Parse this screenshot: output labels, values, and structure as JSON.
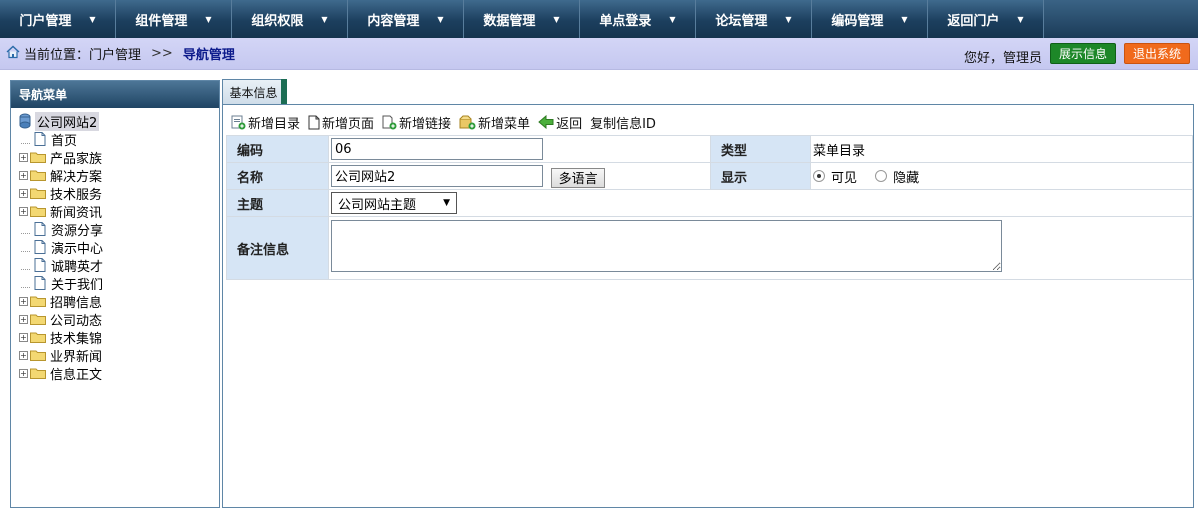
{
  "top_menu": [
    {
      "label": "门户管理"
    },
    {
      "label": "组件管理"
    },
    {
      "label": "组织权限"
    },
    {
      "label": "内容管理"
    },
    {
      "label": "数据管理"
    },
    {
      "label": "单点登录"
    },
    {
      "label": "论坛管理"
    },
    {
      "label": "编码管理"
    },
    {
      "label": "返回门户"
    }
  ],
  "breadcrumb": {
    "prefix": "当前位置：门户管理",
    "separator": ">>",
    "current": "导航管理"
  },
  "header": {
    "greeting": "您好，管理员",
    "show_info": "展示信息",
    "exit": "退出系统"
  },
  "left_panel": {
    "title": "导航菜单",
    "root": "公司网站2",
    "items": [
      {
        "label": "首页",
        "type": "page"
      },
      {
        "label": "产品家族",
        "type": "folder"
      },
      {
        "label": "解决方案",
        "type": "folder"
      },
      {
        "label": "技术服务",
        "type": "folder"
      },
      {
        "label": "新闻资讯",
        "type": "folder"
      },
      {
        "label": "资源分享",
        "type": "page"
      },
      {
        "label": "演示中心",
        "type": "page"
      },
      {
        "label": "诚聘英才",
        "type": "page"
      },
      {
        "label": "关于我们",
        "type": "page"
      },
      {
        "label": "招聘信息",
        "type": "folder"
      },
      {
        "label": "公司动态",
        "type": "folder"
      },
      {
        "label": "技术集锦",
        "type": "folder"
      },
      {
        "label": "业界新闻",
        "type": "folder"
      },
      {
        "label": "信息正文",
        "type": "folder"
      }
    ]
  },
  "tab": {
    "label": "基本信息"
  },
  "toolbar": {
    "new_dir": "新增目录",
    "new_page": "新增页面",
    "new_link": "新增链接",
    "new_menu": "新增菜单",
    "back": "返回",
    "copy_id": "复制信息ID"
  },
  "form": {
    "code_label": "编码",
    "code_value": "06",
    "type_label": "类型",
    "type_value": "菜单目录",
    "name_label": "名称",
    "name_value": "公司网站2",
    "multilang": "多语言",
    "display_label": "显示",
    "visible": "可见",
    "hidden": "隐藏",
    "theme_label": "主题",
    "theme_value": "公司网站主题",
    "remark_label": "备注信息"
  }
}
